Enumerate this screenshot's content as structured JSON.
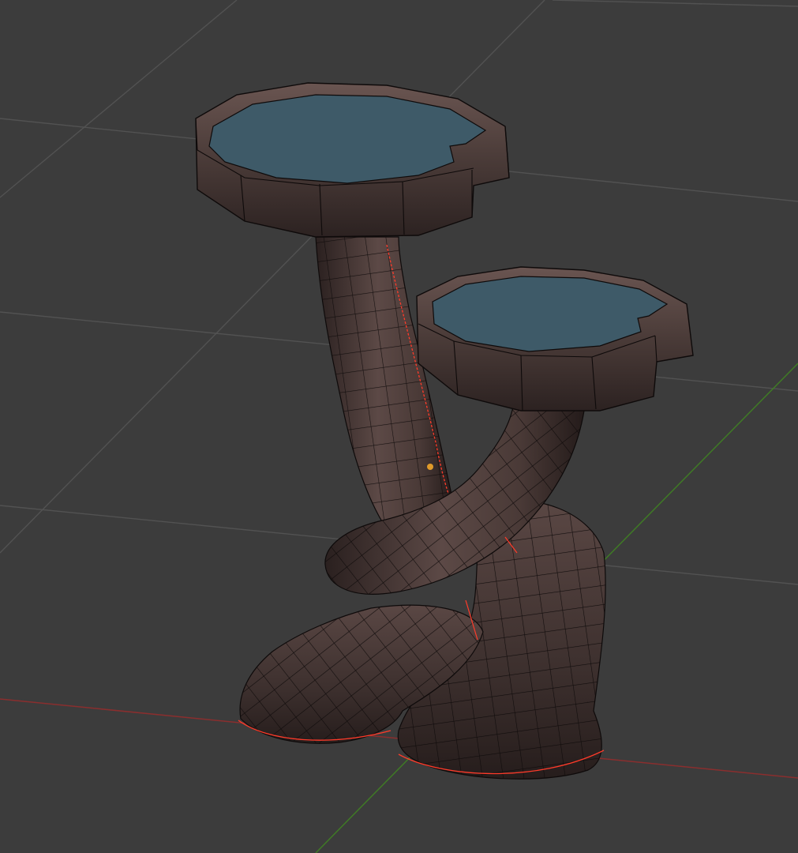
{
  "viewport": {
    "background": "#3c3c3c",
    "grid_color": "#4f4f4f",
    "x_axis_color": "#a83232",
    "y_axis_color": "#4a8a2a"
  },
  "model": {
    "body_color": "#3a2e2c",
    "body_highlight": "#6b5652",
    "wire_color": "#0e0a0a",
    "seam_color": "#ff3b2a",
    "tray_top_color": "#3e5a68",
    "pivot_color": "#e09a2a"
  }
}
